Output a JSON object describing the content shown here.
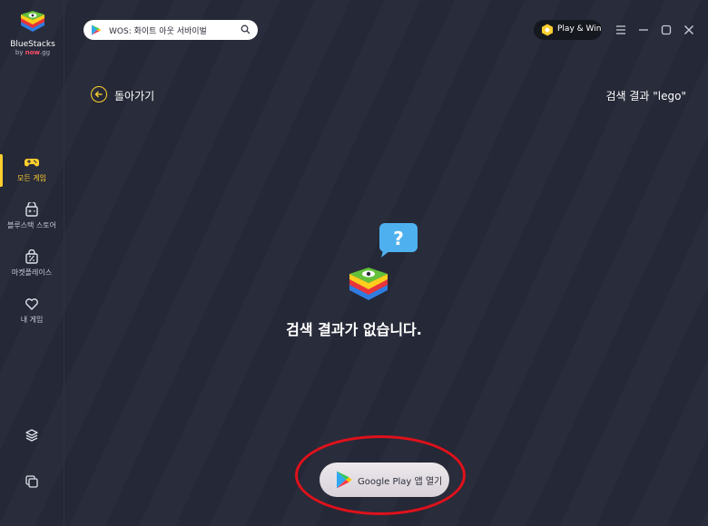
{
  "app": {
    "logo_name": "BlueStacks",
    "logo_by": "by",
    "logo_brand": "now",
    "logo_brand_suffix": ".gg"
  },
  "search": {
    "value": "WOS: 화이트 아웃 서바이벌"
  },
  "header": {
    "play_win_label": "Play & Win"
  },
  "sidebar": {
    "items": [
      {
        "label": "모든 게임",
        "icon": "gamepad-icon",
        "active": true
      },
      {
        "label": "블루스택 스토어",
        "icon": "store-icon",
        "active": false
      },
      {
        "label": "마켓플레이스",
        "icon": "discount-bag-icon",
        "active": false
      },
      {
        "label": "내 게임",
        "icon": "heart-icon",
        "active": false
      }
    ],
    "bottom_icons": [
      "layers-icon",
      "multi-instance-icon"
    ]
  },
  "content": {
    "back_label": "돌아가기",
    "result_title": "검색 결과 \"lego\"",
    "empty_message": "검색 결과가 없습니다.",
    "open_google_play_label": "Google Play 앱 열기"
  },
  "colors": {
    "background": "#252836",
    "accent": "#ffcf2e",
    "highlight": "#e0111b"
  }
}
